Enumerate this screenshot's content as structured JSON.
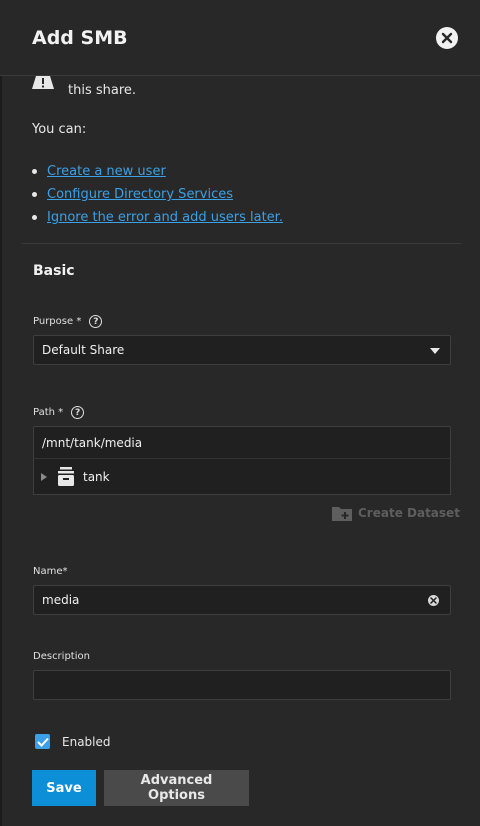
{
  "dialog": {
    "title": "Add SMB"
  },
  "warning": {
    "text": "this share.",
    "you_can": "You can:"
  },
  "links": [
    "Create a new user",
    "Configure Directory Services",
    "Ignore the error and add users later."
  ],
  "section": {
    "title": "Basic"
  },
  "purpose": {
    "label": "Purpose",
    "required": "*",
    "value": "Default Share"
  },
  "path": {
    "label": "Path",
    "required": "*",
    "value": "/mnt/tank/media",
    "tree_item": "tank",
    "create_dataset_label": "Create Dataset"
  },
  "name": {
    "label": "Name",
    "required": "*",
    "value": "media"
  },
  "description": {
    "label": "Description",
    "value": ""
  },
  "enabled": {
    "label": "Enabled",
    "checked": true
  },
  "buttons": {
    "save": "Save",
    "advanced": "Advanced Options"
  },
  "colors": {
    "accent": "#0d8fd8",
    "link": "#3ca0e6",
    "background": "#282828"
  }
}
